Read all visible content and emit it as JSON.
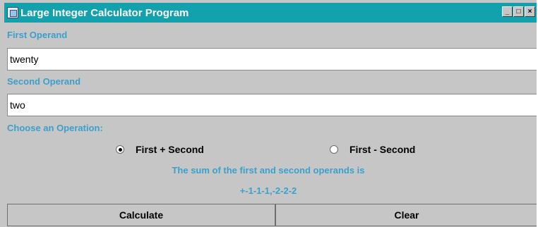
{
  "window": {
    "title": "Large Integer Calculator Program",
    "controls": [
      "_",
      "□",
      "×"
    ]
  },
  "first_operand": {
    "label": "First Operand",
    "value": "twenty"
  },
  "second_operand": {
    "label": "Second Operand",
    "value": "two"
  },
  "operation": {
    "label": "Choose an Operation:",
    "options": [
      {
        "label": "First + Second",
        "selected": true
      },
      {
        "label": "First - Second",
        "selected": false
      }
    ]
  },
  "result": {
    "message": "The sum of the first and second operands is",
    "value": "+-1-1-1,-2-2-2"
  },
  "buttons": {
    "calculate": "Calculate",
    "clear": "Clear"
  },
  "colors": {
    "titlebar": "#13a1ad",
    "label_text": "#3aa0cc",
    "background": "#c6c6c6"
  }
}
